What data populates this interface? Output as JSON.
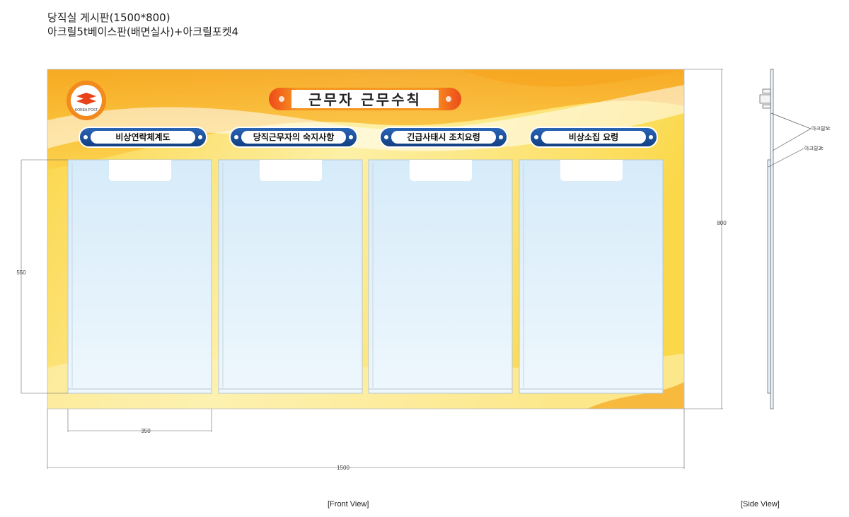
{
  "header": {
    "line1": "당직실 게시판(1500*800)",
    "line2": "아크릴5t베이스판(배면실사)+아크릴포켓4"
  },
  "board": {
    "logo_text": "KOREA POST",
    "title": "근무자 근무수칙",
    "pockets": [
      {
        "label": "비상연락체계도"
      },
      {
        "label": "당직근무자의 숙지사항"
      },
      {
        "label": "긴급사태시 조치요령"
      },
      {
        "label": "비상소집 요령"
      }
    ]
  },
  "dimensions": {
    "pocket_height": "550",
    "pocket_width": "350",
    "board_width": "1500",
    "board_height": "800"
  },
  "side_view": {
    "callout_5t": "아크릴5t",
    "callout_3t": "아크릴3t"
  },
  "view_labels": {
    "front": "[Front View]",
    "side": "[Side View]"
  },
  "colors": {
    "board_yellow": "#fbd84a",
    "board_orange": "#f7a51f",
    "title_red": "#e8431b",
    "label_navy": "#1a4f9c",
    "pocket_blue": "#e3f1fb"
  }
}
